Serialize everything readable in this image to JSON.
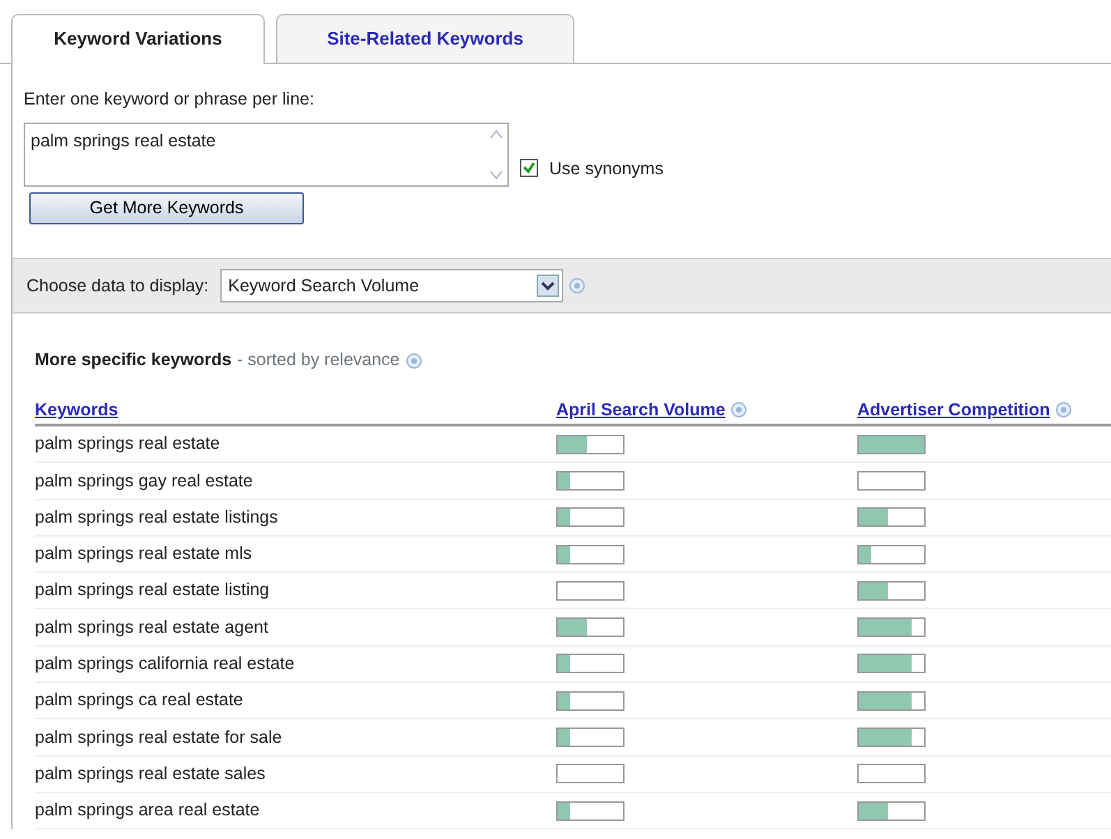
{
  "tabs": [
    {
      "label": "Keyword Variations",
      "selected": true
    },
    {
      "label": "Site-Related Keywords",
      "selected": false
    }
  ],
  "input": {
    "label": "Enter one keyword or phrase per line:",
    "value": "palm springs real estate"
  },
  "synonyms": {
    "label": "Use synonyms",
    "checked": true
  },
  "submit_button": "Get More Keywords",
  "display": {
    "label": "Choose data to display:",
    "value": "Keyword Search Volume"
  },
  "heading": {
    "title": "More specific keywords",
    "subtitle": "- sorted by relevance"
  },
  "table": {
    "columns": [
      "Keywords",
      "April Search Volume",
      "Advertiser Competition"
    ],
    "rows": [
      {
        "keyword": "palm springs real estate",
        "volume": {
          "level": 0.45
        },
        "competition": {
          "level": 1
        }
      },
      {
        "keyword": "palm springs gay real estate",
        "volume": {
          "level": 0.2
        },
        "competition": {
          "level": 0
        }
      },
      {
        "keyword": "palm springs real estate listings",
        "volume": {
          "level": 0.2
        },
        "competition": {
          "level": 0.45
        }
      },
      {
        "keyword": "palm springs real estate mls",
        "volume": {
          "level": 0.2
        },
        "competition": {
          "level": 0.2
        }
      },
      {
        "keyword": "palm springs real estate listing",
        "volume": {
          "level": 0
        },
        "competition": {
          "level": 0.45
        }
      },
      {
        "keyword": "palm springs real estate agent",
        "volume": {
          "level": 0.45
        },
        "competition": {
          "level": 0.8
        }
      },
      {
        "keyword": "palm springs california real estate",
        "volume": {
          "level": 0.2
        },
        "competition": {
          "level": 0.8
        }
      },
      {
        "keyword": "palm springs ca real estate",
        "volume": {
          "level": 0.2
        },
        "competition": {
          "level": 0.8
        }
      },
      {
        "keyword": "palm springs real estate for sale",
        "volume": {
          "level": 0.2
        },
        "competition": {
          "level": 0.8
        }
      },
      {
        "keyword": "palm springs real estate sales",
        "volume": {
          "level": 0
        },
        "competition": {
          "level": 0
        }
      },
      {
        "keyword": "palm springs area real estate",
        "volume": {
          "level": 0.2
        },
        "competition": {
          "level": 0.45
        }
      }
    ]
  }
}
